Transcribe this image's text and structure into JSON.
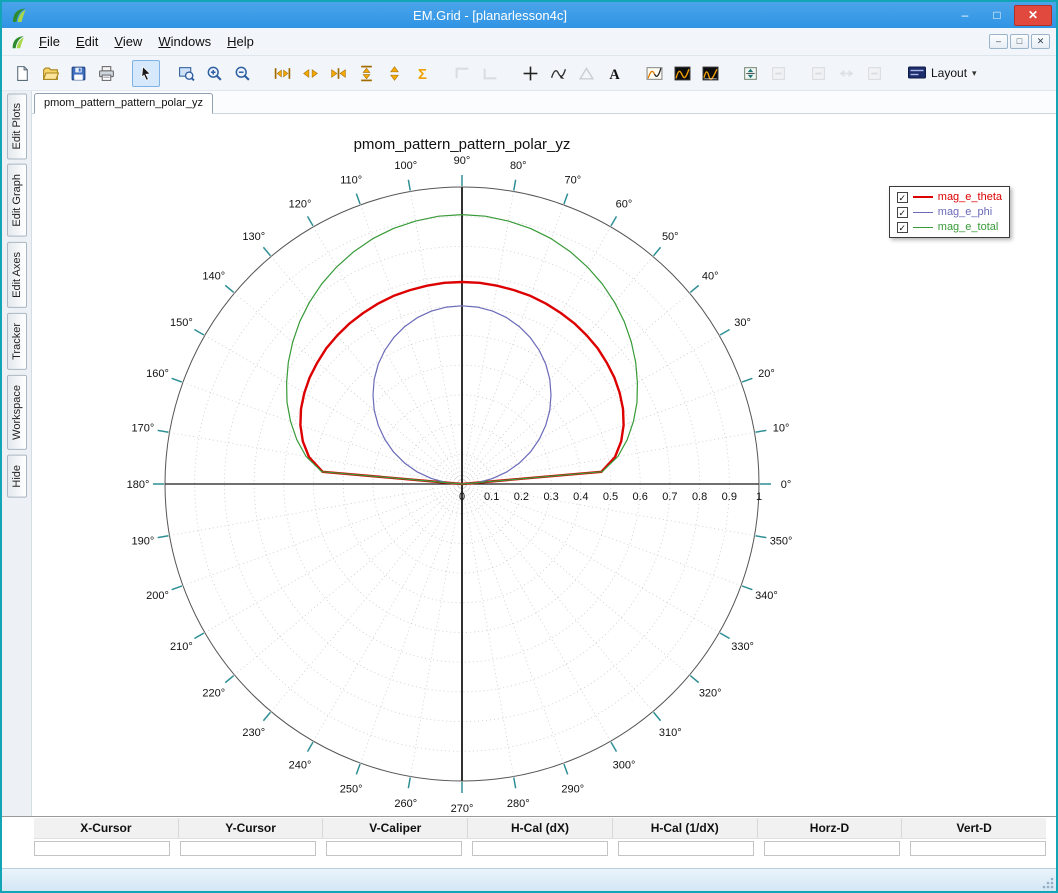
{
  "window": {
    "title": "EM.Grid - [planarlesson4c]",
    "controls": {
      "minimize": "–",
      "maximize": "□",
      "close": "✕"
    },
    "mdi_controls": {
      "minimize": "–",
      "restore": "□",
      "close": "✕"
    }
  },
  "menu": {
    "items": [
      "File",
      "Edit",
      "View",
      "Windows",
      "Help"
    ]
  },
  "toolbar": {
    "layout_label": "Layout",
    "caret": "▾",
    "buttons": [
      {
        "name": "new-document",
        "icon": "doc"
      },
      {
        "name": "open-file",
        "icon": "folder"
      },
      {
        "name": "save-file",
        "icon": "floppy"
      },
      {
        "name": "print",
        "icon": "printer"
      },
      {
        "sep": true
      },
      {
        "name": "pointer-select",
        "icon": "pointer",
        "selected": true
      },
      {
        "sep": true
      },
      {
        "name": "zoom-window",
        "icon": "zoomrect"
      },
      {
        "name": "zoom-in",
        "icon": "zoomin"
      },
      {
        "name": "zoom-out",
        "icon": "zoomout"
      },
      {
        "sep": true
      },
      {
        "name": "expand-horizontal",
        "icon": "hexpand"
      },
      {
        "name": "pan-horizontal",
        "icon": "hpan"
      },
      {
        "name": "fit-horizontal",
        "icon": "hfit"
      },
      {
        "name": "expand-vertical",
        "icon": "vexpand"
      },
      {
        "name": "pan-vertical",
        "icon": "vpan"
      },
      {
        "name": "autoscale-sum",
        "icon": "sigma"
      },
      {
        "sep": true
      },
      {
        "name": "edge-tool-left",
        "icon": "corner1",
        "disabled": true
      },
      {
        "name": "edge-tool-right",
        "icon": "corner2",
        "disabled": true
      },
      {
        "sep": true
      },
      {
        "name": "crosshair",
        "icon": "cross"
      },
      {
        "name": "trace-curve",
        "icon": "curve"
      },
      {
        "name": "marker-triangle",
        "icon": "triangle",
        "disabled": true
      },
      {
        "name": "add-text",
        "icon": "textA"
      },
      {
        "sep": true
      },
      {
        "name": "pattern-plot-light",
        "icon": "patternlight"
      },
      {
        "name": "pattern-plot-dark",
        "icon": "patterndark"
      },
      {
        "name": "pattern-plot-dark-2",
        "icon": "patterndark2"
      },
      {
        "sep": true
      },
      {
        "name": "fit-plot-vertical",
        "icon": "vfitplot"
      },
      {
        "name": "pan-plot-vertical",
        "icon": "graysq",
        "disabled": true
      },
      {
        "sep": true
      },
      {
        "name": "align-plot-left",
        "icon": "graysq",
        "disabled": true
      },
      {
        "name": "fit-plot-horizontal",
        "icon": "grayh",
        "disabled": true
      },
      {
        "name": "align-plot-right",
        "icon": "graysq",
        "disabled": true
      },
      {
        "sep": true
      },
      {
        "name": "layout-menu",
        "icon": "layout",
        "label": true
      }
    ]
  },
  "sidebar": {
    "tabs": [
      "Edit Plots",
      "Edit Graph",
      "Edit Axes",
      "Tracker",
      "Workspace",
      "Hide"
    ]
  },
  "document": {
    "tab_label": "pmom_pattern_pattern_polar_yz"
  },
  "chart_data": {
    "type": "polar-line",
    "title": "pmom_pattern_pattern_polar_yz",
    "rmax": 1,
    "radial_ticks": [
      0,
      0.1,
      0.2,
      0.3,
      0.4,
      0.5,
      0.6,
      0.7,
      0.8,
      0.9,
      1
    ],
    "angle_tick_step_deg": 10,
    "degree_suffix": "°",
    "grid": true,
    "legend_position": "top-right",
    "legend_checkbox_glyph": "✓",
    "angles_deg": [
      0,
      5,
      10,
      15,
      20,
      25,
      30,
      35,
      40,
      45,
      50,
      55,
      60,
      65,
      70,
      75,
      80,
      85,
      90,
      95,
      100,
      105,
      110,
      115,
      120,
      125,
      130,
      135,
      140,
      145,
      150,
      155,
      160,
      165,
      170,
      175,
      180
    ],
    "series": [
      {
        "name": "mag_e_theta",
        "color": "#dd0000",
        "width": 2.4,
        "checked": true,
        "values": [
          0,
          0.471,
          0.523,
          0.555,
          0.579,
          0.598,
          0.613,
          0.626,
          0.636,
          0.646,
          0.653,
          0.66,
          0.665,
          0.67,
          0.674,
          0.676,
          0.678,
          0.68,
          0.68,
          0.68,
          0.678,
          0.676,
          0.674,
          0.67,
          0.665,
          0.66,
          0.653,
          0.646,
          0.636,
          0.626,
          0.613,
          0.598,
          0.579,
          0.555,
          0.523,
          0.471,
          0
        ]
      },
      {
        "name": "mag_e_phi",
        "color": "#6a6ab8",
        "width": 1.2,
        "checked": true,
        "values": [
          0,
          0.052,
          0.104,
          0.155,
          0.205,
          0.254,
          0.3,
          0.344,
          0.386,
          0.424,
          0.46,
          0.492,
          0.52,
          0.544,
          0.564,
          0.58,
          0.591,
          0.598,
          0.6,
          0.598,
          0.591,
          0.58,
          0.564,
          0.544,
          0.52,
          0.492,
          0.46,
          0.424,
          0.386,
          0.344,
          0.3,
          0.254,
          0.205,
          0.155,
          0.104,
          0.052,
          0
        ]
      },
      {
        "name": "mag_e_total",
        "color": "#379a37",
        "width": 1.2,
        "checked": true,
        "values": [
          0,
          0.474,
          0.533,
          0.576,
          0.614,
          0.65,
          0.682,
          0.714,
          0.744,
          0.773,
          0.799,
          0.823,
          0.844,
          0.863,
          0.879,
          0.891,
          0.899,
          0.905,
          0.907,
          0.905,
          0.899,
          0.891,
          0.879,
          0.863,
          0.844,
          0.823,
          0.799,
          0.773,
          0.744,
          0.714,
          0.682,
          0.65,
          0.614,
          0.576,
          0.533,
          0.474,
          0
        ]
      }
    ],
    "colors": {
      "tick": "#2e8f96",
      "grid": "#c9c9c9",
      "axis": "#1a1a1a",
      "outer_circle": "#555555"
    }
  },
  "readout": {
    "headers": [
      "X-Cursor",
      "Y-Cursor",
      "V-Caliper",
      "H-Cal (dX)",
      "H-Cal (1/dX)",
      "Horz-D",
      "Vert-D"
    ],
    "values": [
      "",
      "",
      "",
      "",
      "",
      "",
      ""
    ]
  },
  "statusbar": {
    "text": ""
  }
}
